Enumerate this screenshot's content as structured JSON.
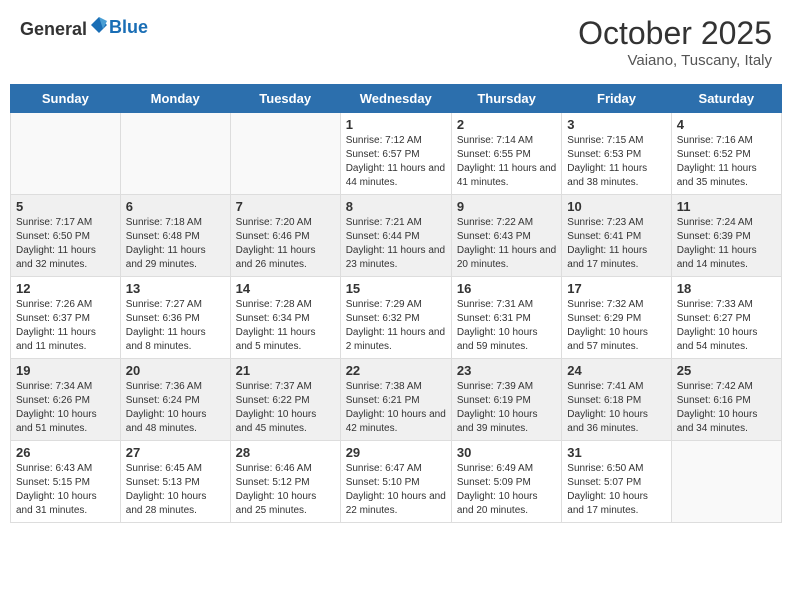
{
  "header": {
    "logo_general": "General",
    "logo_blue": "Blue",
    "month_title": "October 2025",
    "subtitle": "Vaiano, Tuscany, Italy"
  },
  "days_of_week": [
    "Sunday",
    "Monday",
    "Tuesday",
    "Wednesday",
    "Thursday",
    "Friday",
    "Saturday"
  ],
  "weeks": [
    [
      {
        "day": "",
        "info": ""
      },
      {
        "day": "",
        "info": ""
      },
      {
        "day": "",
        "info": ""
      },
      {
        "day": "1",
        "info": "Sunrise: 7:12 AM\nSunset: 6:57 PM\nDaylight: 11 hours and 44 minutes."
      },
      {
        "day": "2",
        "info": "Sunrise: 7:14 AM\nSunset: 6:55 PM\nDaylight: 11 hours and 41 minutes."
      },
      {
        "day": "3",
        "info": "Sunrise: 7:15 AM\nSunset: 6:53 PM\nDaylight: 11 hours and 38 minutes."
      },
      {
        "day": "4",
        "info": "Sunrise: 7:16 AM\nSunset: 6:52 PM\nDaylight: 11 hours and 35 minutes."
      }
    ],
    [
      {
        "day": "5",
        "info": "Sunrise: 7:17 AM\nSunset: 6:50 PM\nDaylight: 11 hours and 32 minutes."
      },
      {
        "day": "6",
        "info": "Sunrise: 7:18 AM\nSunset: 6:48 PM\nDaylight: 11 hours and 29 minutes."
      },
      {
        "day": "7",
        "info": "Sunrise: 7:20 AM\nSunset: 6:46 PM\nDaylight: 11 hours and 26 minutes."
      },
      {
        "day": "8",
        "info": "Sunrise: 7:21 AM\nSunset: 6:44 PM\nDaylight: 11 hours and 23 minutes."
      },
      {
        "day": "9",
        "info": "Sunrise: 7:22 AM\nSunset: 6:43 PM\nDaylight: 11 hours and 20 minutes."
      },
      {
        "day": "10",
        "info": "Sunrise: 7:23 AM\nSunset: 6:41 PM\nDaylight: 11 hours and 17 minutes."
      },
      {
        "day": "11",
        "info": "Sunrise: 7:24 AM\nSunset: 6:39 PM\nDaylight: 11 hours and 14 minutes."
      }
    ],
    [
      {
        "day": "12",
        "info": "Sunrise: 7:26 AM\nSunset: 6:37 PM\nDaylight: 11 hours and 11 minutes."
      },
      {
        "day": "13",
        "info": "Sunrise: 7:27 AM\nSunset: 6:36 PM\nDaylight: 11 hours and 8 minutes."
      },
      {
        "day": "14",
        "info": "Sunrise: 7:28 AM\nSunset: 6:34 PM\nDaylight: 11 hours and 5 minutes."
      },
      {
        "day": "15",
        "info": "Sunrise: 7:29 AM\nSunset: 6:32 PM\nDaylight: 11 hours and 2 minutes."
      },
      {
        "day": "16",
        "info": "Sunrise: 7:31 AM\nSunset: 6:31 PM\nDaylight: 10 hours and 59 minutes."
      },
      {
        "day": "17",
        "info": "Sunrise: 7:32 AM\nSunset: 6:29 PM\nDaylight: 10 hours and 57 minutes."
      },
      {
        "day": "18",
        "info": "Sunrise: 7:33 AM\nSunset: 6:27 PM\nDaylight: 10 hours and 54 minutes."
      }
    ],
    [
      {
        "day": "19",
        "info": "Sunrise: 7:34 AM\nSunset: 6:26 PM\nDaylight: 10 hours and 51 minutes."
      },
      {
        "day": "20",
        "info": "Sunrise: 7:36 AM\nSunset: 6:24 PM\nDaylight: 10 hours and 48 minutes."
      },
      {
        "day": "21",
        "info": "Sunrise: 7:37 AM\nSunset: 6:22 PM\nDaylight: 10 hours and 45 minutes."
      },
      {
        "day": "22",
        "info": "Sunrise: 7:38 AM\nSunset: 6:21 PM\nDaylight: 10 hours and 42 minutes."
      },
      {
        "day": "23",
        "info": "Sunrise: 7:39 AM\nSunset: 6:19 PM\nDaylight: 10 hours and 39 minutes."
      },
      {
        "day": "24",
        "info": "Sunrise: 7:41 AM\nSunset: 6:18 PM\nDaylight: 10 hours and 36 minutes."
      },
      {
        "day": "25",
        "info": "Sunrise: 7:42 AM\nSunset: 6:16 PM\nDaylight: 10 hours and 34 minutes."
      }
    ],
    [
      {
        "day": "26",
        "info": "Sunrise: 6:43 AM\nSunset: 5:15 PM\nDaylight: 10 hours and 31 minutes."
      },
      {
        "day": "27",
        "info": "Sunrise: 6:45 AM\nSunset: 5:13 PM\nDaylight: 10 hours and 28 minutes."
      },
      {
        "day": "28",
        "info": "Sunrise: 6:46 AM\nSunset: 5:12 PM\nDaylight: 10 hours and 25 minutes."
      },
      {
        "day": "29",
        "info": "Sunrise: 6:47 AM\nSunset: 5:10 PM\nDaylight: 10 hours and 22 minutes."
      },
      {
        "day": "30",
        "info": "Sunrise: 6:49 AM\nSunset: 5:09 PM\nDaylight: 10 hours and 20 minutes."
      },
      {
        "day": "31",
        "info": "Sunrise: 6:50 AM\nSunset: 5:07 PM\nDaylight: 10 hours and 17 minutes."
      },
      {
        "day": "",
        "info": ""
      }
    ]
  ]
}
